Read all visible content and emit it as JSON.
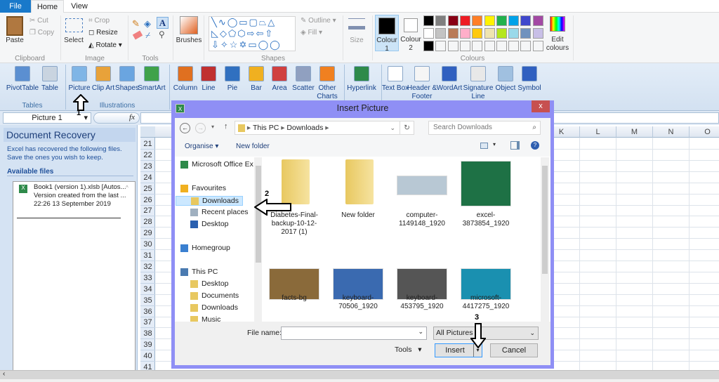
{
  "tabs": {
    "file": "File",
    "home": "Home",
    "view": "View"
  },
  "paint": {
    "clipboard": {
      "paste": "Paste",
      "cut": "Cut",
      "copy": "Copy",
      "label": "Clipboard"
    },
    "image": {
      "select": "Select",
      "crop": "Crop",
      "resize": "Resize",
      "rotate": "Rotate",
      "label": "Image"
    },
    "tools": {
      "label": "Tools"
    },
    "brushes": "Brushes",
    "shapes": {
      "outline": "Outline",
      "fill": "Fill",
      "label": "Shapes"
    },
    "size": "Size",
    "colours": {
      "colour1": "Colour 1",
      "colour2": "Colour 2",
      "edit": "Edit colours",
      "label": "Colours",
      "row1": [
        "#000000",
        "#7f7f7f",
        "#880015",
        "#ed1c24",
        "#ff7f27",
        "#fff200",
        "#22b14c",
        "#00a2e8",
        "#3f48cc",
        "#a349a4"
      ],
      "row2": [
        "#ffffff",
        "#c3c3c3",
        "#b97a57",
        "#ffaec9",
        "#ffc90e",
        "#efe4b0",
        "#b5e61d",
        "#99d9ea",
        "#7092be",
        "#c8bfe7"
      ],
      "row3": [
        "#000000",
        "#f5f6f7",
        "#f5f6f7",
        "#f5f6f7",
        "#f5f6f7",
        "#f5f6f7",
        "#f5f6f7",
        "#f5f6f7",
        "#f5f6f7",
        "#f5f6f7"
      ]
    }
  },
  "excel_ribbon": {
    "items": [
      {
        "label": "PivotTable",
        "color": "#5b8fd1"
      },
      {
        "label": "Table",
        "color": "#c9d4e0"
      },
      {
        "label": "Picture",
        "color": "#7fb5e6"
      },
      {
        "label": "Clip Art",
        "color": "#e8a23a"
      },
      {
        "label": "Shapes",
        "color": "#6aa5e0"
      },
      {
        "label": "SmartArt",
        "color": "#3fa24a"
      },
      {
        "label": "Column",
        "color": "#e07020"
      },
      {
        "label": "Line",
        "color": "#c03030"
      },
      {
        "label": "Pie",
        "color": "#3070c0"
      },
      {
        "label": "Bar",
        "color": "#f0b020"
      },
      {
        "label": "Area",
        "color": "#d04040"
      },
      {
        "label": "Scatter",
        "color": "#90a0c0"
      },
      {
        "label": "Other Charts",
        "color": "#f08020"
      },
      {
        "label": "Hyperlink",
        "color": "#2e8a4a"
      },
      {
        "label": "Text Box",
        "color": "#ffffff"
      },
      {
        "label": "Header & Footer",
        "color": "#f5f5f5"
      },
      {
        "label": "WordArt",
        "color": "#3060c0"
      },
      {
        "label": "Signature Line",
        "color": "#e8e8e8"
      },
      {
        "label": "Object",
        "color": "#a0c0e0"
      },
      {
        "label": "Symbol",
        "color": "#3060c0"
      }
    ],
    "groups": {
      "tables": "Tables",
      "illustrations": "Illustrations"
    }
  },
  "formula_bar": {
    "name_box": "Picture 1",
    "fx": "fx"
  },
  "recovery": {
    "title": "Document Recovery",
    "message": "Excel has recovered the following files.  Save the ones you wish to keep.",
    "available": "Available files",
    "file_name": "Book1 (version 1).xlsb  [Autos...",
    "file_desc": "Version created from the last ...",
    "file_time": "22:26 13 September 2019"
  },
  "grid": {
    "rows": [
      "21",
      "22",
      "23",
      "24",
      "25",
      "26",
      "27",
      "28",
      "29",
      "30",
      "31",
      "32",
      "33",
      "34",
      "35",
      "36",
      "37",
      "38",
      "39",
      "40",
      "41"
    ],
    "columns": [
      "K",
      "L",
      "M",
      "N",
      "O"
    ]
  },
  "dialog": {
    "title": "Insert Picture",
    "close": "x",
    "path": [
      "This PC",
      "Downloads"
    ],
    "search_placeholder": "Search Downloads",
    "organise": "Organise",
    "new_folder": "New folder",
    "nav": [
      "Microsoft Office Ex",
      "Favourites",
      "Downloads",
      "Recent places",
      "Desktop",
      "Homegroup",
      "This PC",
      "Desktop",
      "Documents",
      "Downloads",
      "Music"
    ],
    "files": [
      {
        "name": "Diabetes-Final-backup-10-12-2017 (1)",
        "type": "folder"
      },
      {
        "name": "New folder",
        "type": "folder"
      },
      {
        "name": "computer-1149148_1920",
        "type": "image",
        "color": "#b8c8d4"
      },
      {
        "name": "excel-3873854_1920",
        "type": "image",
        "color": "#1e7145"
      },
      {
        "name": "facts-bg",
        "type": "image",
        "color": "#8a6a3a"
      },
      {
        "name": "keyboard-70506_1920",
        "type": "image",
        "color": "#3a6ab0"
      },
      {
        "name": "keyboard-453795_1920",
        "type": "image",
        "color": "#555555"
      },
      {
        "name": "microsoft-4417275_1920",
        "type": "image",
        "color": "#1a90b0"
      }
    ],
    "file_name_label": "File name:",
    "file_name_value": "",
    "filter": "All Pictures",
    "tools": "Tools",
    "insert": "Insert",
    "cancel": "Cancel"
  },
  "annotations": {
    "step1": "1",
    "step2": "2",
    "step3": "3"
  }
}
